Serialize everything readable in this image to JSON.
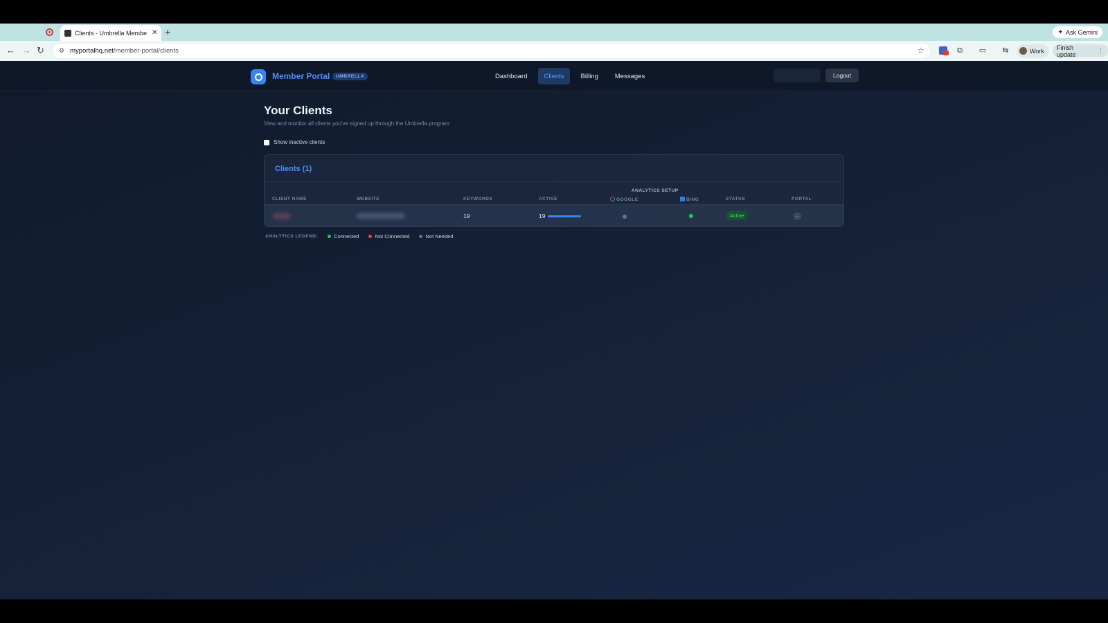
{
  "browser": {
    "tab_title": "Clients - Umbrella Member P",
    "new_tab": "+",
    "ask_gemini": "Ask Gemini",
    "url_host": "myportalhq.net",
    "url_path": "/member-portal/clients",
    "profile": "Work",
    "finish_update": "Finish update"
  },
  "header": {
    "brand": "Member Portal",
    "badge": "UMBRELLA",
    "nav": [
      "Dashboard",
      "Clients",
      "Billing",
      "Messages"
    ],
    "active_nav": "Clients",
    "logout": "Logout"
  },
  "page": {
    "title": "Your Clients",
    "subtitle": "View and monitor all clients you've signed up through the Umbrella program",
    "show_inactive_label": "Show inactive clients",
    "show_inactive_checked": false
  },
  "table": {
    "card_title": "Clients (1)",
    "group_header": "ANALYTICS SETUP",
    "columns": [
      "CLIENT NAME",
      "WEBSITE",
      "KEYWORDS",
      "ACTIVE",
      "GOOGLE",
      "BING",
      "STATUS",
      "PORTAL"
    ],
    "rows": [
      {
        "keywords": "19",
        "active": "19",
        "active_fraction": 1.0,
        "google": "not-needed",
        "bing": "connected",
        "status": "Active",
        "portal": "–"
      }
    ]
  },
  "legend": {
    "label": "ANALYTICS LEGEND:",
    "items": [
      {
        "label": "Connected",
        "color": "#22c55e"
      },
      {
        "label": "Not Connected",
        "color": "#ef4444"
      },
      {
        "label": "Not Needed",
        "color": "#64748b"
      }
    ]
  },
  "colors": {
    "accent": "#3b82f6",
    "connected": "#22c55e",
    "not_connected": "#ef4444",
    "not_needed": "#64748b"
  }
}
